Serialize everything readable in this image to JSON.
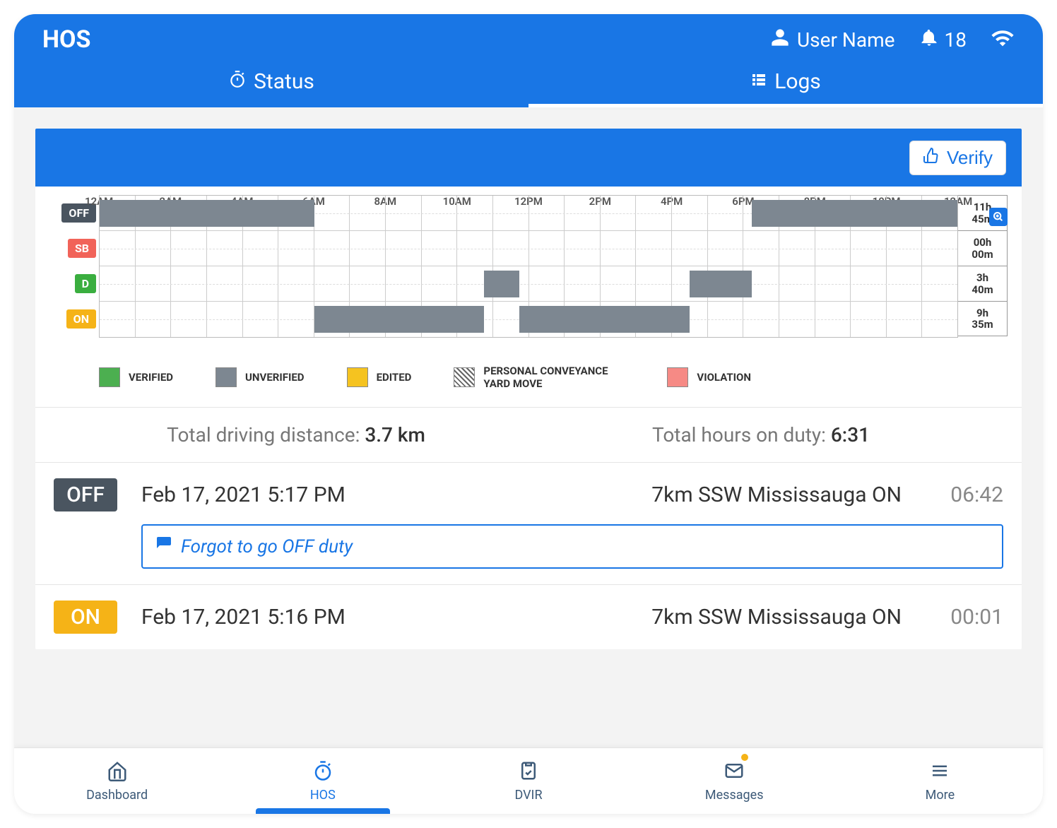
{
  "header": {
    "title": "HOS",
    "user": "User Name",
    "notifications": "18"
  },
  "tabs": {
    "status": "Status",
    "logs": "Logs",
    "active": "logs"
  },
  "chart_data": {
    "type": "timeline",
    "timeLabels": [
      "12AM",
      "2AM",
      "4AM",
      "6AM",
      "8AM",
      "10AM",
      "12PM",
      "2PM",
      "4PM",
      "6PM",
      "8PM",
      "10PM",
      "12AM"
    ],
    "rows": [
      {
        "key": "OFF",
        "label": "OFF",
        "total_h": "11h",
        "total_m": "45m"
      },
      {
        "key": "SB",
        "label": "SB",
        "total_h": "00h",
        "total_m": "00m"
      },
      {
        "key": "D",
        "label": "D",
        "total_h": "3h",
        "total_m": "40m"
      },
      {
        "key": "ON",
        "label": "ON",
        "total_h": "9h",
        "total_m": "35m"
      }
    ],
    "bars": [
      {
        "row": "OFF",
        "startH": 0.0,
        "endH": 6.0,
        "status": "unverified"
      },
      {
        "row": "ON",
        "startH": 6.0,
        "endH": 10.75,
        "status": "unverified"
      },
      {
        "row": "D",
        "startH": 10.75,
        "endH": 11.75,
        "status": "unverified"
      },
      {
        "row": "ON",
        "startH": 11.75,
        "endH": 16.5,
        "status": "unverified"
      },
      {
        "row": "D",
        "startH": 16.5,
        "endH": 18.25,
        "status": "unverified"
      },
      {
        "row": "OFF",
        "startH": 18.25,
        "endH": 24.0,
        "status": "unverified"
      }
    ],
    "legend": {
      "verified": "VERIFIED",
      "unverified": "UNVERIFIED",
      "edited": "EDITED",
      "pc": "PERSONAL CONVEYANCE YARD MOVE",
      "violation": "VIOLATION"
    }
  },
  "verify_label": "Verify",
  "summary": {
    "distance_label": "Total driving distance: ",
    "distance_value": "3.7 km",
    "hours_label": "Total hours on duty: ",
    "hours_value": "6:31"
  },
  "log_entries": [
    {
      "status": "OFF",
      "status_class": "badge-off",
      "date": "Feb 17, 2021 5:17 PM",
      "location": "7km SSW Mississauga ON",
      "duration": "06:42",
      "note": "Forgot to go OFF duty"
    },
    {
      "status": "ON",
      "status_class": "badge-on",
      "date": "Feb 17, 2021 5:16 PM",
      "location": "7km SSW Mississauga ON",
      "duration": "00:01"
    }
  ],
  "bottom_nav": {
    "dashboard": "Dashboard",
    "hos": "HOS",
    "dvir": "DVIR",
    "messages": "Messages",
    "more": "More"
  }
}
